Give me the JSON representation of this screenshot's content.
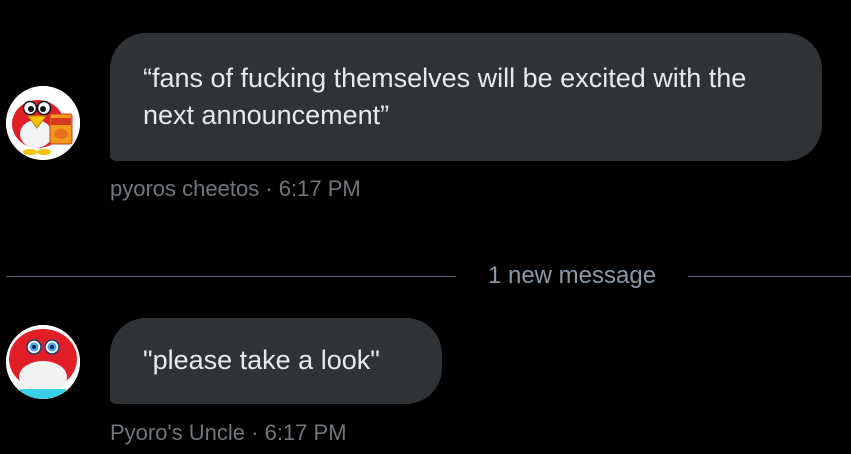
{
  "messages": [
    {
      "avatar_icon": "pyoro-cheetos-avatar-icon",
      "text": "“fans of fucking themselves will be excited with the next announcement”",
      "sender": "pyoros cheetos",
      "time": "6:17 PM",
      "separator": " · "
    },
    {
      "avatar_icon": "pyoro-uncle-avatar-icon",
      "text": "\"please take a look\"",
      "sender": "Pyoro's Uncle",
      "time": "6:17 PM",
      "separator": " · "
    }
  ],
  "divider": {
    "label": "1 new message"
  },
  "colors": {
    "background": "#000000",
    "bubble": "#2f3336",
    "bubble_text": "#e7e9ea",
    "meta_text": "#71767b",
    "divider_line": "#536471",
    "pyoro_red": "#e21f26",
    "cheetos_orange": "#f39a1b"
  }
}
